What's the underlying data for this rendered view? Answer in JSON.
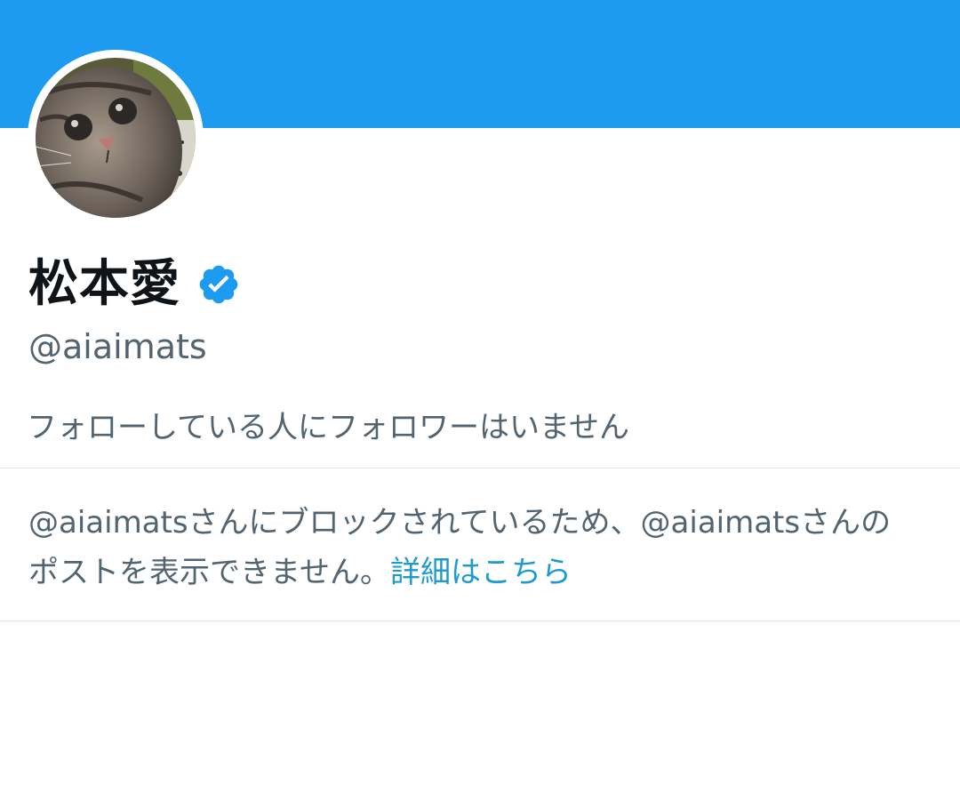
{
  "colors": {
    "banner": "#1d9bf0",
    "verified_badge": "#1d9bf0",
    "link": "#1d9bd1",
    "secondary_text": "#536471",
    "primary_text": "#0f1419"
  },
  "profile": {
    "display_name": "松本愛",
    "handle": "@aiaimats",
    "avatar_icon": "cat-photo",
    "verified_icon": "verified-badge-icon",
    "followers_you_know": "フォローしている人にフォロワーはいません"
  },
  "blocked_notice": {
    "line1": "@aiaimatsさんにブロックされているため、@aiaimatsさんの",
    "line2": "ポストを表示できません。",
    "learn_more_label": "詳細はこちら"
  }
}
